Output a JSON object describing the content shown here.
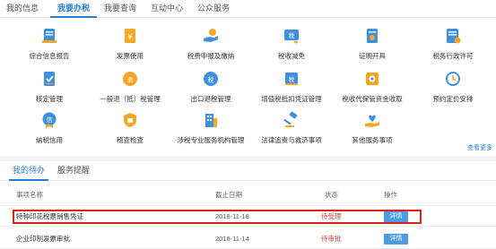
{
  "topnav": {
    "tabs": [
      {
        "label": "我的信息",
        "active": false
      },
      {
        "label": "我要办税",
        "active": true
      },
      {
        "label": "我要查询",
        "active": false
      },
      {
        "label": "互动中心",
        "active": false
      },
      {
        "label": "公众服务",
        "active": false
      }
    ]
  },
  "services": {
    "rows": [
      [
        {
          "label": "综合信息报告",
          "icon": "document-report-icon"
        },
        {
          "label": "发票使用",
          "icon": "invoice-yen-icon"
        },
        {
          "label": "税费申报及缴纳",
          "icon": "hand-coin-icon"
        },
        {
          "label": "税收减免",
          "icon": "tax-reduction-icon"
        },
        {
          "label": "证明开具",
          "icon": "certificate-icon"
        },
        {
          "label": "税务行政许可",
          "icon": "license-icon"
        }
      ],
      [
        {
          "label": "核定管理",
          "icon": "approved-document-icon"
        },
        {
          "label": "一般退（抵）税管理",
          "icon": "refund-icon"
        },
        {
          "label": "出口退税管理",
          "icon": "export-refund-icon"
        },
        {
          "label": "增值税抵扣凭证管理",
          "icon": "vat-voucher-icon"
        },
        {
          "label": "税收代保管资金收取",
          "icon": "safe-fund-icon"
        },
        {
          "label": "预约定价安排",
          "icon": "appointment-clock-icon"
        }
      ],
      [
        {
          "label": "纳税信用",
          "icon": "credit-badge-icon"
        },
        {
          "label": "稽查检查",
          "icon": "inspection-shield-icon"
        },
        {
          "label": "涉税专业服务机构管理",
          "icon": "building-icon"
        },
        {
          "label": "法律追责与救济事项",
          "icon": "gavel-icon"
        },
        {
          "label": "其他服务事项",
          "icon": "heart-hand-icon"
        }
      ]
    ],
    "more_label": "查看更多"
  },
  "todo": {
    "tabs": [
      {
        "label": "我的待办",
        "active": true
      },
      {
        "label": "服务提醒",
        "active": false
      }
    ],
    "columns": [
      "事项名称",
      "截止日期",
      "状态",
      "操作"
    ],
    "rows": [
      {
        "name": "特种印花税票销售凭证",
        "date": "2018-11-18",
        "status": "待受理",
        "action": "详情"
      },
      {
        "name": "企业印制发票审批",
        "date": "2018-11-14",
        "status": "待审批",
        "action": "详情"
      }
    ]
  },
  "colors": {
    "accent": "#2a7fd4",
    "icon_orange": "#f5a623",
    "icon_blue": "#3d8fe0",
    "status_red": "#e23b3b",
    "highlight_red": "#d9251d"
  }
}
